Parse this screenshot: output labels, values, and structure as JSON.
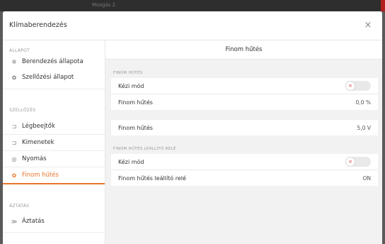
{
  "window": {
    "topbar_title": "Mozgás 2"
  },
  "dialog": {
    "title": "Klímaberendezés",
    "close_glyph": "×"
  },
  "sidebar": {
    "sections": [
      {
        "title": "ÁLLAPOT"
      },
      {
        "title": "SZELLŐZÉS"
      },
      {
        "title": "ÁZTATÁS"
      }
    ],
    "items": [
      {
        "label": "Berendezés állapota",
        "icon": "fan-icon",
        "glyph": "✲"
      },
      {
        "label": "Szellőzési állapot",
        "icon": "vent-state-icon",
        "glyph": "✿"
      },
      {
        "label": "Légbeejtők",
        "icon": "air-inlet-icon",
        "glyph": "⊐"
      },
      {
        "label": "Kimenetek",
        "icon": "outlet-icon",
        "glyph": "⊐"
      },
      {
        "label": "Nyomás",
        "icon": "pressure-icon",
        "glyph": "◎"
      },
      {
        "label": "Finom hűtés",
        "icon": "cooling-icon",
        "glyph": "✿",
        "active": true
      },
      {
        "label": "Áztatás",
        "icon": "soaking-icon",
        "glyph": "≫"
      }
    ]
  },
  "main": {
    "title": "Finom hűtés",
    "groups": [
      {
        "title": "FINOM HŰTÉS"
      },
      {
        "title": "FINOM HŰTÉS LEÁLLÍTÓ RELÉ"
      }
    ],
    "rows": [
      {
        "label": "Kézi mód",
        "type": "toggle",
        "toggle_glyph": "×"
      },
      {
        "label": "Finom hűtés",
        "value": "0,0 %"
      },
      {
        "label": "Finom hűtés",
        "value": "5,0 V"
      },
      {
        "label": "Kézi mód",
        "type": "toggle",
        "toggle_glyph": "×"
      },
      {
        "label": "Finom hűtés leállító relé",
        "value": "ON"
      }
    ]
  },
  "colors": {
    "accent": "#e8762b",
    "toggle_off_x": "#d83a3a"
  }
}
